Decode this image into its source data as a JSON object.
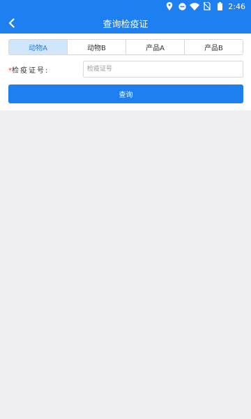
{
  "status_bar": {
    "time": "2:46",
    "icons": [
      "location-icon",
      "dnd-icon",
      "wifi-icon",
      "no-sim-icon",
      "battery-icon"
    ]
  },
  "header": {
    "title": "查询检疫证",
    "back_icon": "chevron-left-icon"
  },
  "tabs": [
    {
      "label": "动物A",
      "active": true
    },
    {
      "label": "动物B",
      "active": false
    },
    {
      "label": "产品A",
      "active": false
    },
    {
      "label": "产品B",
      "active": false
    }
  ],
  "form": {
    "required_mark": "*",
    "label": "检疫证号:",
    "placeholder": "检疫证号",
    "value": ""
  },
  "actions": {
    "query_label": "查询"
  },
  "colors": {
    "primary": "#1e7ff0",
    "tab_active_bg": "#cfe6fb",
    "required": "#e53935",
    "page_bg": "#efeff4"
  }
}
